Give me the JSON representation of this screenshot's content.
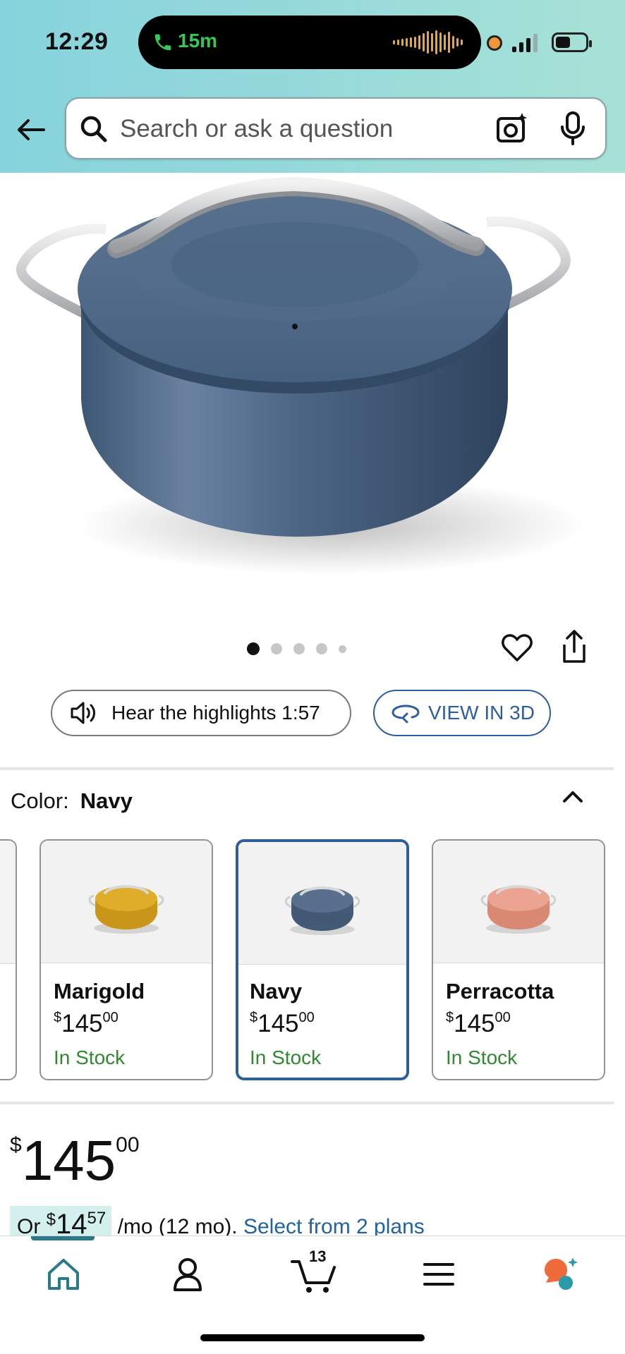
{
  "status_bar": {
    "time": "12:29",
    "call_duration": "15m",
    "accent_colors": {
      "call": "#34c759",
      "waveform": "#f2a23a",
      "mic_in_use": "#f0963a"
    }
  },
  "search": {
    "placeholder": "Search or ask a question"
  },
  "product": {
    "image_pager": {
      "count": 5,
      "active_index": 0
    },
    "hear_highlights_label": "Hear the highlights 1:57",
    "view_3d_label": "VIEW IN 3D"
  },
  "color_selector": {
    "label": "Color:",
    "selected": "Navy",
    "options": [
      {
        "name": "Marigold",
        "price_dollar": "$",
        "price_whole": "145",
        "price_cents": "00",
        "stock": "In Stock",
        "color": "#d9a421"
      },
      {
        "name": "Navy",
        "price_dollar": "$",
        "price_whole": "145",
        "price_cents": "00",
        "stock": "In Stock",
        "color": "#4e6682"
      },
      {
        "name": "Perracotta",
        "price_dollar": "$",
        "price_whole": "145",
        "price_cents": "00",
        "stock": "In Stock",
        "color": "#e39b88"
      }
    ]
  },
  "price": {
    "currency": "$",
    "whole": "145",
    "cents": "00"
  },
  "monthly": {
    "prefix": "Or",
    "currency": "$",
    "whole": "14",
    "cents": "57",
    "term": "/mo (12 mo).",
    "link": "Select from 2 plans"
  },
  "bottom_nav": {
    "items": [
      "home-icon",
      "account-icon",
      "cart-icon",
      "menu-icon",
      "rufus-icon"
    ],
    "active": "home-icon",
    "cart_count": "13"
  },
  "colors": {
    "header_start": "#86d3dd",
    "header_end": "#a7e2d6",
    "link": "#2162a1",
    "stock": "#2f8a2f",
    "selected_border": "#2f5f97"
  }
}
